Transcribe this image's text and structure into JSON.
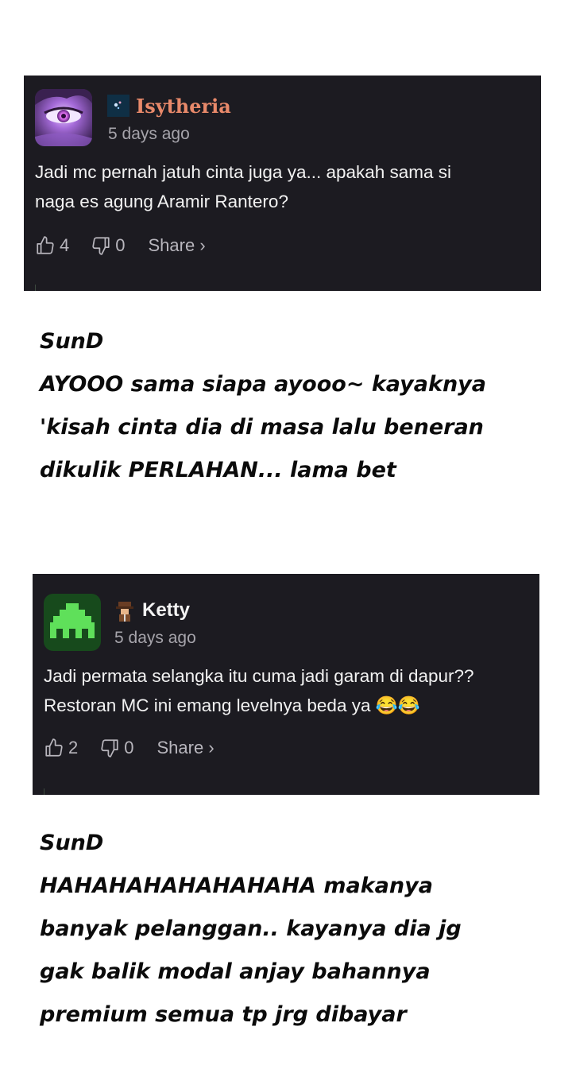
{
  "comments": [
    {
      "username": "Isytheria",
      "username_color": "#e8896a",
      "time": "5 days ago",
      "text_lines": [
        "Jadi mc pernah jatuh cinta juga ya... apakah sama si",
        "naga es agung Aramir Rantero?"
      ],
      "likes": "4",
      "dislikes": "0",
      "share_label": "Share ›",
      "avatar_icon": "purple-eye-avatar",
      "badge_icon": "blue-square-badge-icon"
    },
    {
      "username": "Ketty",
      "username_color": "#f3f3f3",
      "time": "5 days ago",
      "text_lines": [
        "Jadi permata selangka itu cuma jadi garam di dapur??",
        "Restoran MC ini emang levelnya beda ya 😂😂"
      ],
      "likes": "2",
      "dislikes": "0",
      "share_label": "Share ›",
      "avatar_icon": "green-space-invader-avatar",
      "badge_icon": "detective-badge-icon"
    }
  ],
  "replies": [
    {
      "author": "SunD",
      "lines": [
        "AYOOO sama siapa ayooo~ kayaknya",
        "'kisah cinta dia di masa lalu beneran",
        "dikulik PERLAHAN... lama bet"
      ]
    },
    {
      "author": "SunD",
      "lines": [
        "HAHAHAHAHAHAHAHA makanya",
        "banyak pelanggan.. kayanya dia jg",
        "gak balik modal anjay bahannya",
        "premium semua tp jrg dibayar"
      ]
    }
  ],
  "colors": {
    "card_bg": "#1c1b21",
    "muted": "#a6a4ab",
    "text": "#f2f2f2"
  }
}
